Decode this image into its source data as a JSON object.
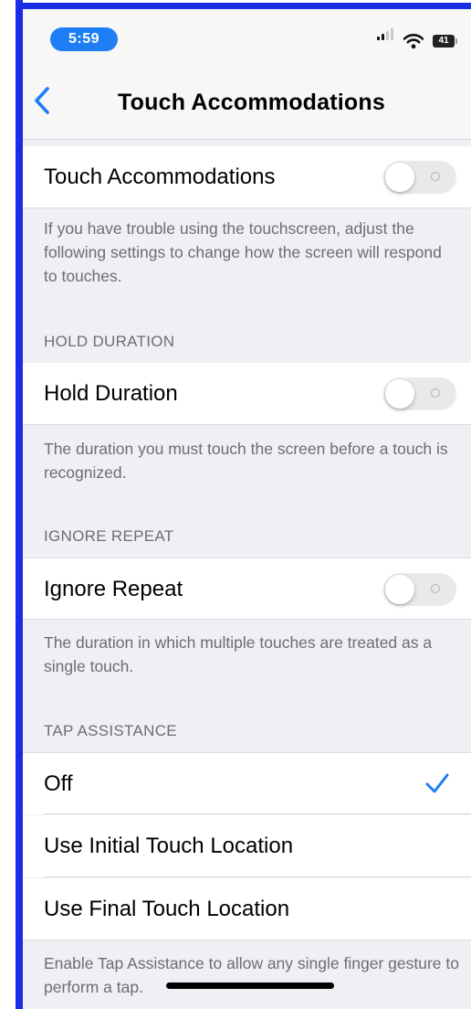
{
  "status_bar": {
    "time": "5:59",
    "battery": "41"
  },
  "nav": {
    "title": "Touch Accommodations"
  },
  "touch_accommodations": {
    "label": "Touch Accommodations",
    "enabled": false,
    "footer": "If you have trouble using the touchscreen, adjust the following settings to change how the screen will respond to touches."
  },
  "hold_duration": {
    "header": "HOLD DURATION",
    "label": "Hold Duration",
    "enabled": false,
    "footer": "The duration you must touch the screen before a touch is recognized."
  },
  "ignore_repeat": {
    "header": "IGNORE REPEAT",
    "label": "Ignore Repeat",
    "enabled": false,
    "footer": "The duration in which multiple touches are treated as a single touch."
  },
  "tap_assistance": {
    "header": "TAP ASSISTANCE",
    "options": [
      {
        "label": "Off",
        "selected": true
      },
      {
        "label": "Use Initial Touch Location",
        "selected": false
      },
      {
        "label": "Use Final Touch Location",
        "selected": false
      }
    ],
    "footer": "Enable Tap Assistance to allow any single finger gesture to perform a tap."
  },
  "colors": {
    "accent": "#1d7ef6",
    "background": "#efeff4",
    "toggle_off": "#e9e9ea",
    "secondary_text": "#6d6d72"
  }
}
